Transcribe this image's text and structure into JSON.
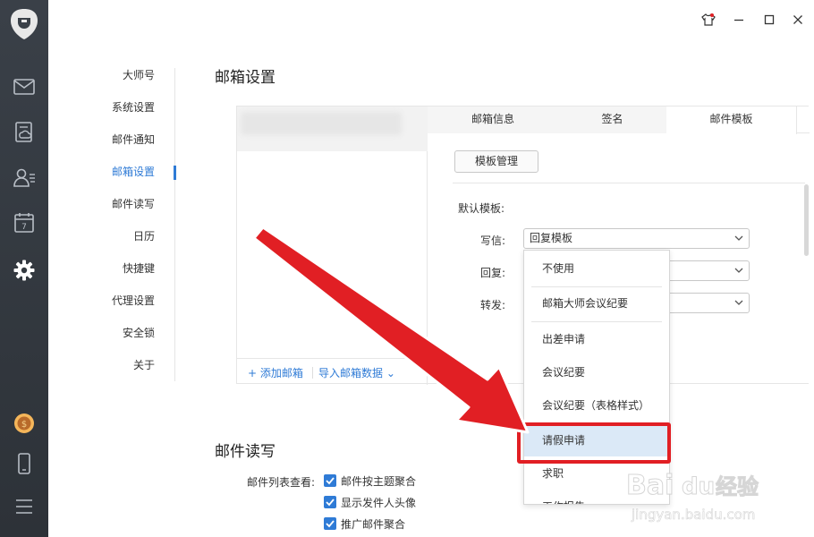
{
  "sidebar_menu": {
    "items": [
      {
        "label": "大师号"
      },
      {
        "label": "系统设置"
      },
      {
        "label": "邮件通知"
      },
      {
        "label": "邮箱设置",
        "active": true
      },
      {
        "label": "邮件读写"
      },
      {
        "label": "日历"
      },
      {
        "label": "快捷键"
      },
      {
        "label": "代理设置"
      },
      {
        "label": "安全锁"
      },
      {
        "label": "关于"
      }
    ]
  },
  "mailbox_settings": {
    "title": "邮箱设置",
    "add_mailbox": "+ 添加邮箱",
    "import_data": "导入邮箱数据 ⌄",
    "tabs": [
      "邮箱信息",
      "签名",
      "邮件模板"
    ],
    "active_tab": "邮件模板",
    "template_manage_button": "模板管理",
    "default_template_label": "默认模板:",
    "write_label": "写信:",
    "reply_label": "回复:",
    "forward_label": "转发:",
    "write_value": "回复模板"
  },
  "dropdown": {
    "options": [
      "不使用",
      "邮箱大师会议纪要",
      "出差申请",
      "会议纪要",
      "会议纪要（表格样式）",
      "请假申请",
      "求职",
      "工作报告"
    ],
    "highlighted": "请假申请"
  },
  "mail_read_write": {
    "title": "邮件读写",
    "list_view_label": "邮件列表查看:",
    "options": [
      {
        "label": "邮件按主题聚合",
        "checked": true
      },
      {
        "label": "显示发件人头像",
        "checked": true
      },
      {
        "label": "推广邮件聚合",
        "checked": true
      }
    ]
  },
  "colors": {
    "accent": "#2f7bd6",
    "annotation_red": "#e11f24",
    "rail": "#343a41",
    "highlight": "#dbe9f7"
  },
  "watermark": {
    "text1": "Baidu经验",
    "text2": "jingyan.baidu.com"
  }
}
